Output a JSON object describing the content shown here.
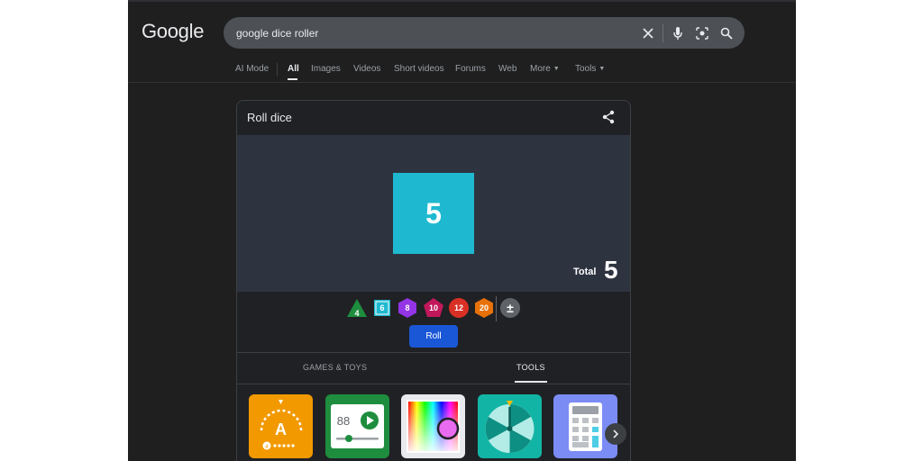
{
  "header": {
    "logo": "Google",
    "search": {
      "value": "google dice roller"
    },
    "icons": [
      "close-icon",
      "microphone-icon",
      "lens-icon",
      "search-icon"
    ]
  },
  "tabs": [
    {
      "label": "AI Mode"
    },
    {
      "label": "All",
      "active": true
    },
    {
      "label": "Images"
    },
    {
      "label": "Videos"
    },
    {
      "label": "Short videos"
    },
    {
      "label": "Forums"
    },
    {
      "label": "Web"
    },
    {
      "label": "More"
    },
    {
      "label": "Tools"
    }
  ],
  "card": {
    "title": "Roll dice",
    "die_value": "5",
    "total_label": "Total",
    "total_value": "5",
    "dice": [
      {
        "label": "4",
        "shape": "triangle",
        "color": "#1e8e3e"
      },
      {
        "label": "6",
        "shape": "square",
        "color": "#1eb9d0"
      },
      {
        "label": "8",
        "shape": "hexagon",
        "color": "#9334e6"
      },
      {
        "label": "10",
        "shape": "diamond",
        "color": "#c2185b"
      },
      {
        "label": "12",
        "shape": "circle",
        "color": "#d93025"
      },
      {
        "label": "20",
        "shape": "hexagon",
        "color": "#e8710a"
      },
      {
        "label": "±",
        "shape": "circle",
        "color": "#5f6368"
      }
    ],
    "roll_label": "Roll",
    "category_tabs": [
      {
        "label": "GAMES & TOYS"
      },
      {
        "label": "TOOLS",
        "active": true
      }
    ],
    "tiles": [
      {
        "name": "metronome",
        "color": "#f29900",
        "letter": "A",
        "dot_label": "4"
      },
      {
        "name": "timer",
        "color": "#1e8e3e",
        "number": "88"
      },
      {
        "name": "color-picker",
        "color": "#e8eaed"
      },
      {
        "name": "spinner",
        "color": "#12b5a5"
      },
      {
        "name": "calculator",
        "color": "#7b8cf5"
      }
    ]
  }
}
